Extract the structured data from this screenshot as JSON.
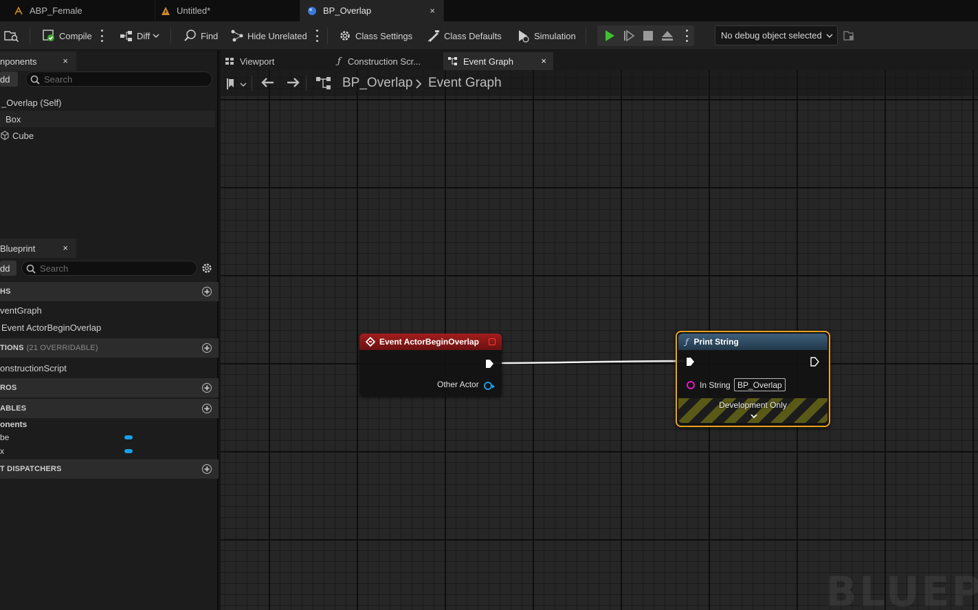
{
  "doc_tabs": [
    {
      "label": "ABP_Female"
    },
    {
      "label": "Untitled*"
    },
    {
      "label": "BP_Overlap",
      "close": "×"
    }
  ],
  "toolbar": {
    "compile": "Compile",
    "diff": "Diff",
    "find": "Find",
    "hide_unrelated": "Hide Unrelated",
    "class_settings": "Class Settings",
    "class_defaults": "Class Defaults",
    "simulation": "Simulation",
    "debug_object": "No debug object selected"
  },
  "components_panel": {
    "title": "nponents",
    "close": "×",
    "add": "dd",
    "search_placeholder": "Search",
    "items": [
      "_Overlap (Self)",
      "Box",
      "Cube"
    ]
  },
  "myblueprint_panel": {
    "title": "Blueprint",
    "close": "×",
    "add": "dd",
    "search_placeholder": "Search",
    "graphs_header": "HS",
    "graph_items": [
      "ventGraph",
      "Event ActorBeginOverlap"
    ],
    "functions_header": "TIONS",
    "functions_sub": "(21 OVERRIDABLE)",
    "function_items": [
      "onstructionScript"
    ],
    "macros_header": "ROS",
    "variables_header": "ABLES",
    "components_group": "onents",
    "variables": [
      "be",
      "x"
    ],
    "dispatchers_header": "T DISPATCHERS"
  },
  "graph_tabs": [
    {
      "label": "Viewport"
    },
    {
      "label": "Construction Scr..."
    },
    {
      "label": "Event Graph",
      "close": "×"
    }
  ],
  "breadcrumb": {
    "blueprint": "BP_Overlap",
    "separator": ">",
    "graph": "Event Graph"
  },
  "nodes": {
    "event": {
      "title": "Event ActorBeginOverlap",
      "pin_other_actor": "Other Actor",
      "header_color": "#8a1616"
    },
    "print": {
      "title": "Print String",
      "pin_in_string": "In String",
      "in_string_value": "BP_Overlap",
      "footer": "Development Only",
      "header_color": "#2f4a60",
      "selection_color": "#f0a21e"
    }
  },
  "watermark": "BLUEPRI"
}
